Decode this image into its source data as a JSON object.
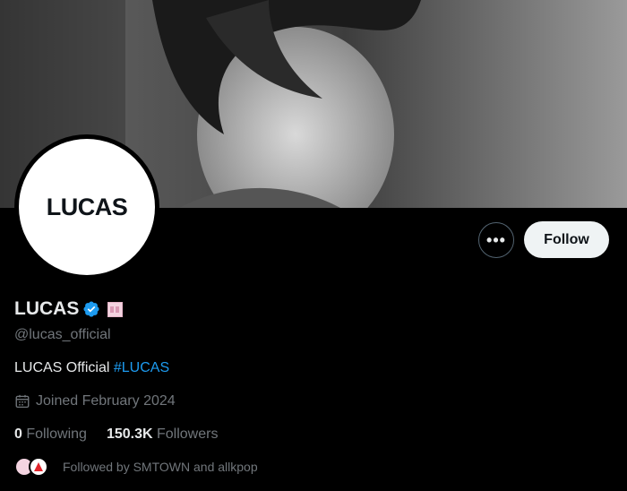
{
  "profile": {
    "avatar_text": "LUCAS",
    "display_name": "LUCAS",
    "handle": "@lucas_official",
    "bio_text": "LUCAS Official ",
    "bio_hashtag": "#LUCAS",
    "joined": "Joined February 2024",
    "following_count": "0",
    "following_label": "Following",
    "followers_count": "150.3K",
    "followers_label": "Followers",
    "followed_by": "Followed by SMTOWN and allkpop"
  },
  "actions": {
    "more_label": "•••",
    "follow_label": "Follow"
  },
  "colors": {
    "background": "#000000",
    "text_primary": "#e7e9ea",
    "text_secondary": "#71767b",
    "link": "#1d9bf0",
    "verified": "#1d9bf0",
    "follow_bg": "#eff3f4"
  },
  "icons": {
    "verified": "verified-badge-icon",
    "affiliation": "affiliation-badge-icon",
    "calendar": "calendar-icon",
    "more": "more-icon"
  }
}
